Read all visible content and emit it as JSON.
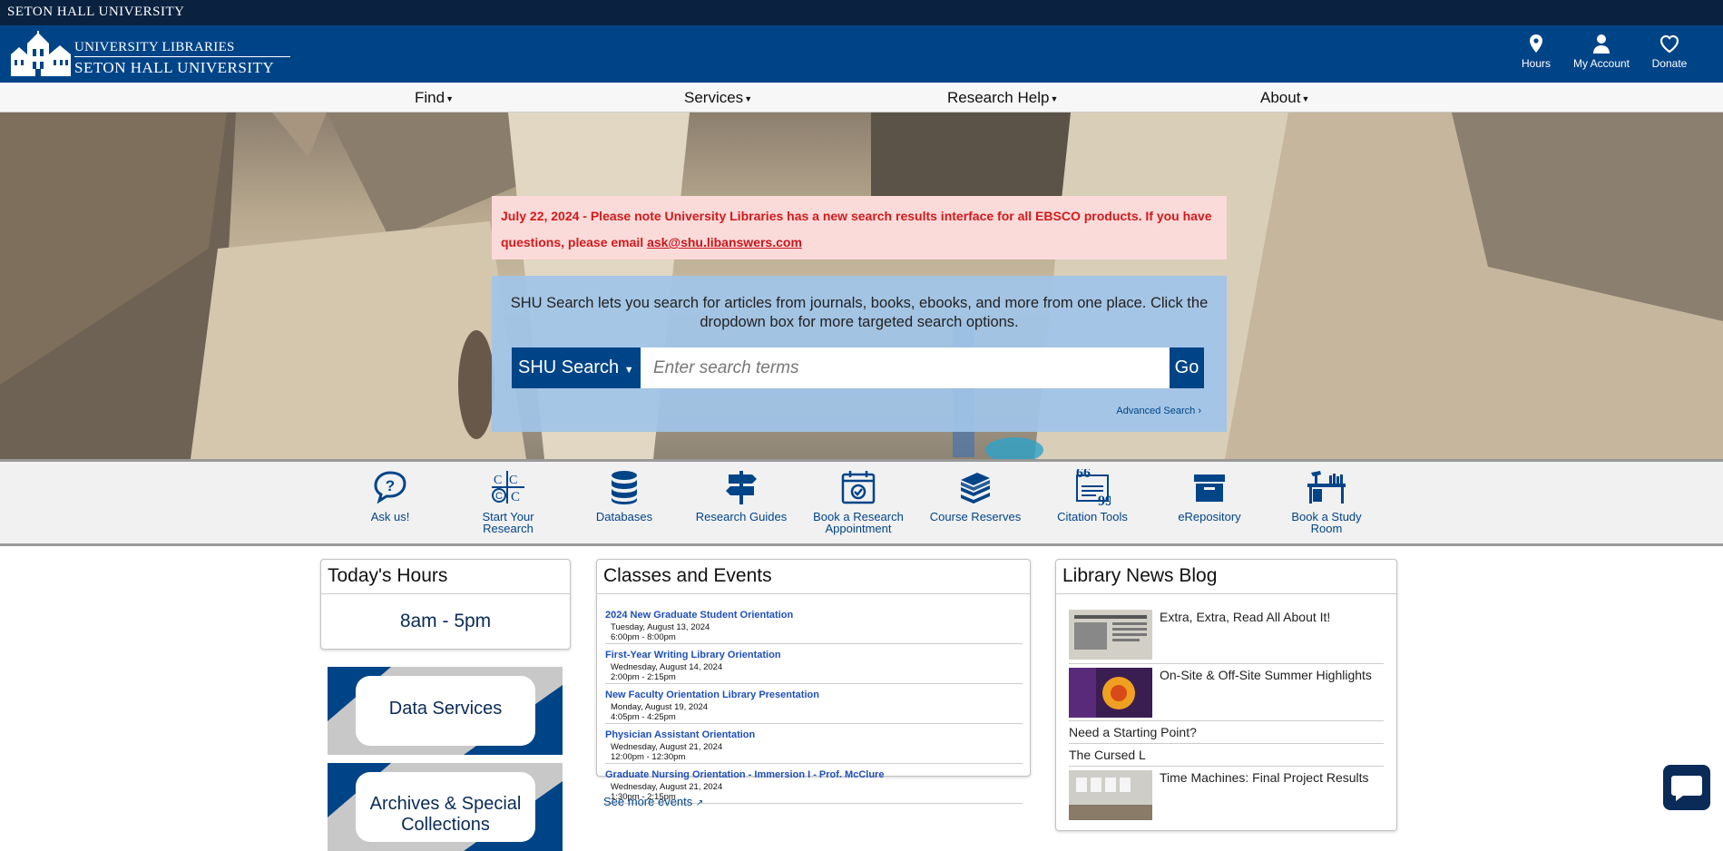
{
  "top_strip": {
    "title": "SETON HALL UNIVERSITY"
  },
  "header": {
    "logo_line1": "UNIVERSITY LIBRARIES",
    "logo_line2": "SETON HALL UNIVERSITY",
    "hours_label": "Hours",
    "account_label": "My Account",
    "donate_label": "Donate"
  },
  "nav": {
    "items": [
      {
        "label": "Find"
      },
      {
        "label": "Services"
      },
      {
        "label": "Research Help"
      },
      {
        "label": "About"
      }
    ]
  },
  "alert": {
    "text": "July 22, 2024 - Please note University Libraries has a new search results interface for all EBSCO products. If you have questions, please email ",
    "email": "ask@shu.libanswers.com"
  },
  "search": {
    "intro": "SHU Search lets you search for articles from journals, books, ebooks, and more from one place. Click the dropdown box for more targeted search options.",
    "scope_label": "SHU Search",
    "placeholder": "Enter search terms",
    "go_label": "Go",
    "advanced_label": "Advanced Search"
  },
  "quick_links": [
    {
      "label": "Ask us!",
      "icon": "question-bubble-icon"
    },
    {
      "label": "Start Your Research",
      "icon": "letters-icon"
    },
    {
      "label": "Databases",
      "icon": "database-icon"
    },
    {
      "label": "Research Guides",
      "icon": "signpost-icon"
    },
    {
      "label": "Book a Research Appointment",
      "icon": "calendar-check-icon"
    },
    {
      "label": "Course Reserves",
      "icon": "books-stack-icon"
    },
    {
      "label": "Citation Tools",
      "icon": "quote-icon"
    },
    {
      "label": "eRepository",
      "icon": "archive-box-icon"
    },
    {
      "label": "Book a Study Room",
      "icon": "study-desk-icon"
    }
  ],
  "hours": {
    "heading": "Today's Hours",
    "value": "8am - 5pm"
  },
  "tiles": [
    {
      "label": "Data Services"
    },
    {
      "label": "Archives & Special Collections"
    }
  ],
  "events": {
    "heading": "Classes and Events",
    "items": [
      {
        "title": "2024 New Graduate Student Orientation",
        "date": "Tuesday, August 13, 2024",
        "time": "6:00pm - 8:00pm"
      },
      {
        "title": "First-Year Writing Library Orientation",
        "date": "Wednesday, August 14, 2024",
        "time": "2:00pm - 2:15pm"
      },
      {
        "title": "New Faculty Orientation Library Presentation",
        "date": "Monday, August 19, 2024",
        "time": "4:05pm - 4:25pm"
      },
      {
        "title": "Physician Assistant Orientation",
        "date": "Wednesday, August 21, 2024",
        "time": "12:00pm - 12:30pm"
      },
      {
        "title": "Graduate Nursing Orientation - Immersion I - Prof. McClure",
        "date": "Wednesday, August 21, 2024",
        "time": "1:30pm - 2:15pm"
      }
    ],
    "more_label": "See more events"
  },
  "news": {
    "heading": "Library News Blog",
    "items": [
      {
        "title": "Extra, Extra, Read All About It!"
      },
      {
        "title": "On-Site & Off-Site Summer Highlights"
      },
      {
        "title": "Need a Starting Point?"
      },
      {
        "title": "The Cursed L"
      },
      {
        "title": "Time Machines: Final Project Results"
      }
    ]
  },
  "colors": {
    "brand_navy": "#004488",
    "top_strip": "#0a2240",
    "alert_text": "#d21a1a",
    "link_blue": "#1f4fb8"
  }
}
